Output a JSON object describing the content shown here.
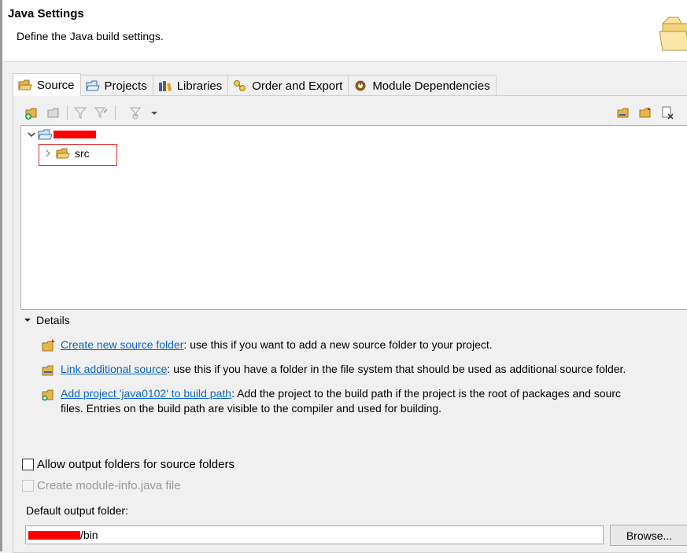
{
  "header": {
    "title": "Java Settings",
    "subtitle": "Define the Java build settings.",
    "icon": "folder-icon"
  },
  "tabs": [
    {
      "label": "Source",
      "icon": "source-folder-icon",
      "active": true
    },
    {
      "label": "Projects",
      "icon": "projects-icon",
      "active": false
    },
    {
      "label": "Libraries",
      "icon": "libraries-icon",
      "active": false
    },
    {
      "label": "Order and Export",
      "icon": "order-export-icon",
      "active": false
    },
    {
      "label": "Module Dependencies",
      "icon": "module-icon",
      "active": false
    }
  ],
  "tree": {
    "project_name_redacted": true,
    "child": "src"
  },
  "details": {
    "heading": "Details",
    "items": [
      {
        "link": "Create new source folder",
        "text": ": use this if you want to add a new source folder to your project.",
        "icon": "new-source-folder-icon"
      },
      {
        "link": "Link additional source",
        "text": ": use this if you have a folder in the file system that should be used as additional source folder.",
        "icon": "link-source-icon"
      },
      {
        "link": "Add project 'java0102' to build path",
        "text": ": Add the project to the build path if the project is the root of packages and sourc",
        "text2": "files. Entries on the build path are visible to the compiler and used for building.",
        "icon": "add-project-icon"
      }
    ]
  },
  "options": {
    "allow_output": "Allow output folders for source folders",
    "allow_output_checked": false,
    "module_info": "Create module-info.java file",
    "module_info_enabled": false
  },
  "output": {
    "label": "Default output folder:",
    "value_suffix": "/bin",
    "browse": "Browse..."
  },
  "colors": {
    "link": "#0b66c2",
    "redaction": "#ff0000",
    "highlight": "#e03030"
  }
}
